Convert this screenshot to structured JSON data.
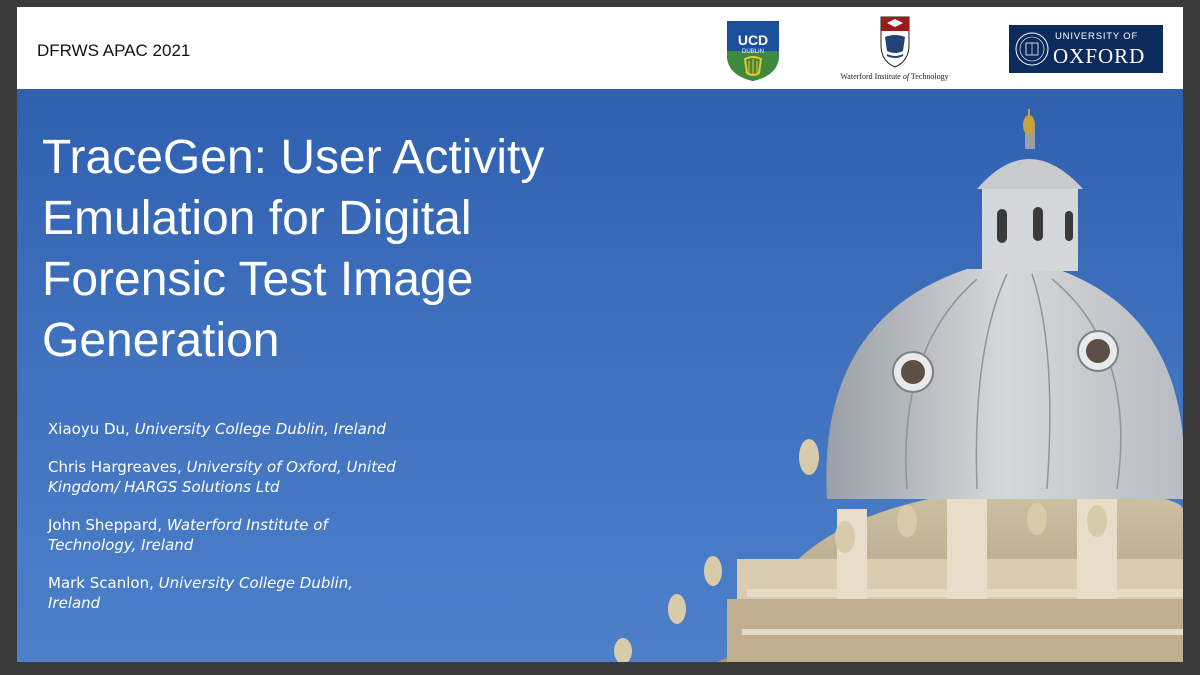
{
  "header": {
    "conference": "DFRWS APAC 2021",
    "logos": {
      "ucd": {
        "top": "UCD",
        "bottom": "DUBLIN"
      },
      "wit": {
        "label_main": "Waterford Institute ",
        "label_italic": "of",
        "label_end": " Technology"
      },
      "oxford": {
        "small": "UNIVERSITY OF",
        "big": "OXFORD"
      }
    }
  },
  "title_lines": [
    "TraceGen: User Activity",
    "Emulation for Digital",
    "Forensic Test Image",
    "Generation"
  ],
  "authors": [
    {
      "name": "Xiaoyu Du, ",
      "affiliation": "University College Dublin, Ireland"
    },
    {
      "name": "Chris Hargreaves, ",
      "affiliation": "University of Oxford, United Kingdom/ HARGS Solutions Ltd"
    },
    {
      "name": "John Sheppard, ",
      "affiliation": "Waterford Institute of Technology, Ireland"
    },
    {
      "name": "Mark Scanlon, ",
      "affiliation": "University College Dublin, Ireland"
    }
  ],
  "colors": {
    "background": "#3a3a3a",
    "main_blue": "#3d6fbd",
    "ucd_blue": "#1a4f9c",
    "ucd_green": "#3c8a3a",
    "oxford_navy": "#0d2a5c"
  }
}
